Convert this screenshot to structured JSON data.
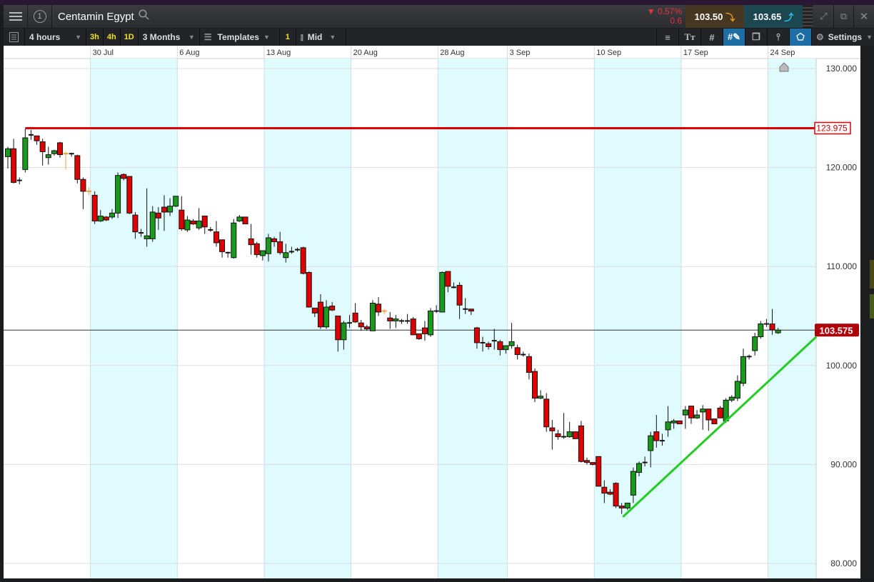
{
  "header": {
    "instrument": "Centamin Egypt",
    "window_number": "1",
    "change_pct": "0.57%",
    "change_abs": "0.6",
    "sell_price": "103.50",
    "buy_price": "103.65"
  },
  "toolbar": {
    "interval": "4 hours",
    "quick_intervals": [
      "3h",
      "4h",
      "1D"
    ],
    "range": "3 Months",
    "templates": "Templates",
    "chart_count": "1",
    "price_type": "Mid",
    "settings": "Settings"
  },
  "colors": {
    "up": "#1a9a1a",
    "down": "#e00000",
    "resistance": "#e00000",
    "trend": "#22cc22",
    "price_label": "#b0000a",
    "stripe": "#e0fbfd"
  },
  "chart_data": {
    "type": "candlestick",
    "date_labels": [
      "30 Jul",
      "6 Aug",
      "13 Aug",
      "20 Aug",
      "28 Aug",
      "3 Sep",
      "10 Sep",
      "17 Sep",
      "24 Sep"
    ],
    "date_label_candle_index": [
      15,
      30,
      45,
      60,
      75,
      87,
      102,
      117,
      132
    ],
    "y_ticks": [
      130,
      120,
      110,
      100,
      90,
      80
    ],
    "y_tick_labels": [
      "130.000",
      "120.000",
      "110.000",
      "100.000",
      "90.000",
      "80.000"
    ],
    "ylim": [
      80,
      130.9
    ],
    "resistance": {
      "price": 123.975,
      "label": "123.975",
      "start_index": 3
    },
    "current": {
      "price": 103.575,
      "label": "103.575"
    },
    "trendline": {
      "from": [
        106.2,
        84.7
      ],
      "to": [
        139.6,
        102.9
      ]
    },
    "candles": [
      [
        121.1,
        122.1,
        119.9,
        121.9
      ],
      [
        121.9,
        122.9,
        118.4,
        118.5
      ],
      [
        118.7,
        119.0,
        118.3,
        118.7
      ],
      [
        119.8,
        123.9,
        119.5,
        123.0
      ],
      [
        123.3,
        123.8,
        122.8,
        123.3
      ],
      [
        123.2,
        123.2,
        122.3,
        122.7
      ],
      [
        122.6,
        122.9,
        120.2,
        121.6
      ],
      [
        121.0,
        122.1,
        120.3,
        121.3
      ],
      [
        121.4,
        121.8,
        121.2,
        121.7
      ],
      [
        122.5,
        122.6,
        121.0,
        121.3
      ],
      [
        121.4,
        121.6,
        119.8,
        121.4
      ],
      [
        121.3,
        121.5,
        121.1,
        121.4
      ],
      [
        121.2,
        121.3,
        118.4,
        118.8
      ],
      [
        118.8,
        119.0,
        115.8,
        117.6
      ],
      [
        117.6,
        118.0,
        117.2,
        117.6
      ],
      [
        117.2,
        117.6,
        114.3,
        114.6
      ],
      [
        114.6,
        115.7,
        114.5,
        115.1
      ],
      [
        115.0,
        115.1,
        114.6,
        114.7
      ],
      [
        115.0,
        115.8,
        114.8,
        115.4
      ],
      [
        115.4,
        119.5,
        114.9,
        119.2
      ],
      [
        119.3,
        119.4,
        118.7,
        118.9
      ],
      [
        119.1,
        119.1,
        115.3,
        115.4
      ],
      [
        115.2,
        115.5,
        112.8,
        113.5
      ],
      [
        113.5,
        113.8,
        113.0,
        113.4
      ],
      [
        112.8,
        117.9,
        112.0,
        113.1
      ],
      [
        112.8,
        116.1,
        112.5,
        115.5
      ],
      [
        115.4,
        116.0,
        113.7,
        114.9
      ],
      [
        116.0,
        117.2,
        113.6,
        115.5
      ],
      [
        115.5,
        116.9,
        115.1,
        116.1
      ],
      [
        116.1,
        117.1,
        116.0,
        117.1
      ],
      [
        115.7,
        117.1,
        113.6,
        113.8
      ],
      [
        113.7,
        115.1,
        113.5,
        114.7
      ],
      [
        114.6,
        114.8,
        114.2,
        114.3
      ],
      [
        113.9,
        115.9,
        113.7,
        114.6
      ],
      [
        115.1,
        115.1,
        113.3,
        114.0
      ],
      [
        113.8,
        114.0,
        113.5,
        113.7
      ],
      [
        113.5,
        114.6,
        112.0,
        112.4
      ],
      [
        112.7,
        112.7,
        110.9,
        111.5
      ],
      [
        111.4,
        111.5,
        110.9,
        111.4
      ],
      [
        110.9,
        114.8,
        110.8,
        114.4
      ],
      [
        114.6,
        115.2,
        114.5,
        115.0
      ],
      [
        115.0,
        115.0,
        114.3,
        114.3
      ],
      [
        112.8,
        114.3,
        111.2,
        112.2
      ],
      [
        112.3,
        112.5,
        110.9,
        111.2
      ],
      [
        111.1,
        111.6,
        110.6,
        111.6
      ],
      [
        111.3,
        113.3,
        110.5,
        112.9
      ],
      [
        112.8,
        113.0,
        112.0,
        112.5
      ],
      [
        112.5,
        113.5,
        111.2,
        111.4
      ],
      [
        110.9,
        112.3,
        110.4,
        111.4
      ],
      [
        111.6,
        112.0,
        111.3,
        111.5
      ],
      [
        111.7,
        111.9,
        111.5,
        111.7
      ],
      [
        111.9,
        112.0,
        109.2,
        109.3
      ],
      [
        109.4,
        109.5,
        105.9,
        105.9
      ],
      [
        105.8,
        105.8,
        104.9,
        105.3
      ],
      [
        106.4,
        107.2,
        103.7,
        103.9
      ],
      [
        103.9,
        106.6,
        103.7,
        105.9
      ],
      [
        106.0,
        106.4,
        105.5,
        105.6
      ],
      [
        105.0,
        105.0,
        101.4,
        102.6
      ],
      [
        102.6,
        104.5,
        101.6,
        104.3
      ],
      [
        104.3,
        105.1,
        103.8,
        104.3
      ],
      [
        105.3,
        106.3,
        104.3,
        104.4
      ],
      [
        104.3,
        104.6,
        103.5,
        103.9
      ],
      [
        103.9,
        104.1,
        103.5,
        103.7
      ],
      [
        103.5,
        106.6,
        103.5,
        106.3
      ],
      [
        106.2,
        106.9,
        105.0,
        105.4
      ],
      [
        105.5,
        105.7,
        105.2,
        105.5
      ],
      [
        104.8,
        105.4,
        103.7,
        104.5
      ],
      [
        104.5,
        105.1,
        103.8,
        104.7
      ],
      [
        104.5,
        104.7,
        104.2,
        104.5
      ],
      [
        104.4,
        105.2,
        104.2,
        104.5
      ],
      [
        104.7,
        104.9,
        103.1,
        103.1
      ],
      [
        103.2,
        103.2,
        102.6,
        102.7
      ],
      [
        103.8,
        104.5,
        102.5,
        103.2
      ],
      [
        103.1,
        105.8,
        102.9,
        105.5
      ],
      [
        105.5,
        106.1,
        105.3,
        105.5
      ],
      [
        105.4,
        109.5,
        105.4,
        109.4
      ],
      [
        109.5,
        109.5,
        107.4,
        108.0
      ],
      [
        107.9,
        108.4,
        107.8,
        107.9
      ],
      [
        108.1,
        108.4,
        104.7,
        106.1
      ],
      [
        105.7,
        106.8,
        105.2,
        105.7
      ],
      [
        105.7,
        105.7,
        105.1,
        105.5
      ],
      [
        103.8,
        103.9,
        101.7,
        102.3
      ],
      [
        102.3,
        102.9,
        101.4,
        102.3
      ],
      [
        102.2,
        102.4,
        101.6,
        101.9
      ],
      [
        102.5,
        103.7,
        101.6,
        102.5
      ],
      [
        102.4,
        102.6,
        101.0,
        101.6
      ],
      [
        101.6,
        102.0,
        101.2,
        102.0
      ],
      [
        102.0,
        104.3,
        101.7,
        102.4
      ],
      [
        101.8,
        102.1,
        100.6,
        101.1
      ],
      [
        101.1,
        101.4,
        100.9,
        101.1
      ],
      [
        100.9,
        101.2,
        98.6,
        99.3
      ],
      [
        99.4,
        99.7,
        96.3,
        96.7
      ],
      [
        96.7,
        97.5,
        96.6,
        96.9
      ],
      [
        96.6,
        97.2,
        93.3,
        93.8
      ],
      [
        93.7,
        94.5,
        91.5,
        93.4
      ],
      [
        93.1,
        93.5,
        92.5,
        92.8
      ],
      [
        92.9,
        95.2,
        92.6,
        92.8
      ],
      [
        92.8,
        94.3,
        92.7,
        93.3
      ],
      [
        93.3,
        93.3,
        92.6,
        92.6
      ],
      [
        93.9,
        94.4,
        90.2,
        90.3
      ],
      [
        90.4,
        90.7,
        90.0,
        90.2
      ],
      [
        90.2,
        90.2,
        89.9,
        90.0
      ],
      [
        90.8,
        90.8,
        87.8,
        87.8
      ],
      [
        87.7,
        88.4,
        86.1,
        87.1
      ],
      [
        87.2,
        87.5,
        86.9,
        87.0
      ],
      [
        88.1,
        88.2,
        85.6,
        85.8
      ],
      [
        85.8,
        86.1,
        85.0,
        85.6
      ],
      [
        85.6,
        86.1,
        85.4,
        86.1
      ],
      [
        86.9,
        89.7,
        86.1,
        89.3
      ],
      [
        89.2,
        90.3,
        88.8,
        90.1
      ],
      [
        90.1,
        90.8,
        89.8,
        90.2
      ],
      [
        91.4,
        93.3,
        89.7,
        92.9
      ],
      [
        93.3,
        95.0,
        91.7,
        92.4
      ],
      [
        92.4,
        93.1,
        91.9,
        92.4
      ],
      [
        93.5,
        95.9,
        92.8,
        94.3
      ],
      [
        94.2,
        94.6,
        93.6,
        94.4
      ],
      [
        94.4,
        94.4,
        94.1,
        94.1
      ],
      [
        95.0,
        95.9,
        93.6,
        95.5
      ],
      [
        95.9,
        95.9,
        94.1,
        94.7
      ],
      [
        94.7,
        95.5,
        94.6,
        95.0
      ],
      [
        95.3,
        96.0,
        93.5,
        95.6
      ],
      [
        95.6,
        95.6,
        93.4,
        94.5
      ],
      [
        94.6,
        94.6,
        94.1,
        94.1
      ],
      [
        95.7,
        95.9,
        94.7,
        94.7
      ],
      [
        94.4,
        96.7,
        94.2,
        96.5
      ],
      [
        96.5,
        97.0,
        96.3,
        96.8
      ],
      [
        96.7,
        99.0,
        96.4,
        98.4
      ],
      [
        98.2,
        101.7,
        97.9,
        100.9
      ],
      [
        100.9,
        101.1,
        100.6,
        100.9
      ],
      [
        101.5,
        103.3,
        101.0,
        102.9
      ],
      [
        102.9,
        104.5,
        102.7,
        104.2
      ],
      [
        104.3,
        104.7,
        103.9,
        104.2
      ],
      [
        104.2,
        105.7,
        103.1,
        103.6
      ],
      [
        103.3,
        103.8,
        103.2,
        103.575
      ]
    ],
    "orange_doji_indices": [
      10,
      14,
      65
    ]
  }
}
